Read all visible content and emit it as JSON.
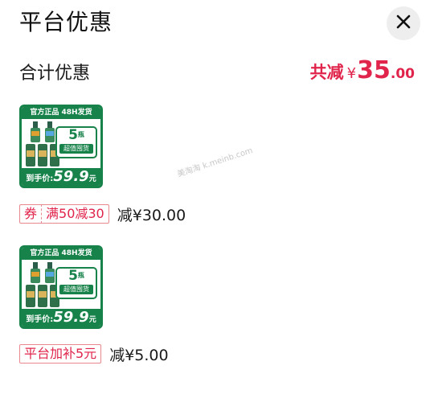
{
  "header": {
    "title": "平台优惠"
  },
  "summary": {
    "label": "合计优惠",
    "prefix": "共减",
    "currency": "¥",
    "amount_int": "35",
    "amount_dec": ".00"
  },
  "product": {
    "banner": "官方正品 48H发货",
    "badge_num": "5",
    "badge_unit": "瓶",
    "badge_sub": "超值囤货",
    "price_label": "到手价:",
    "price_value": "59.9",
    "price_unit": "元"
  },
  "discounts": [
    {
      "tag_left": "券",
      "tag_right": "满50减30",
      "amount": "减¥30.00"
    },
    {
      "tag": "平台加补5元",
      "amount": "减¥5.00"
    }
  ],
  "watermark": "美淘淘 k.meinb.com",
  "colors": {
    "accent": "#e0244b",
    "product_green": "#17824a",
    "close_bg": "#eeeeee"
  }
}
